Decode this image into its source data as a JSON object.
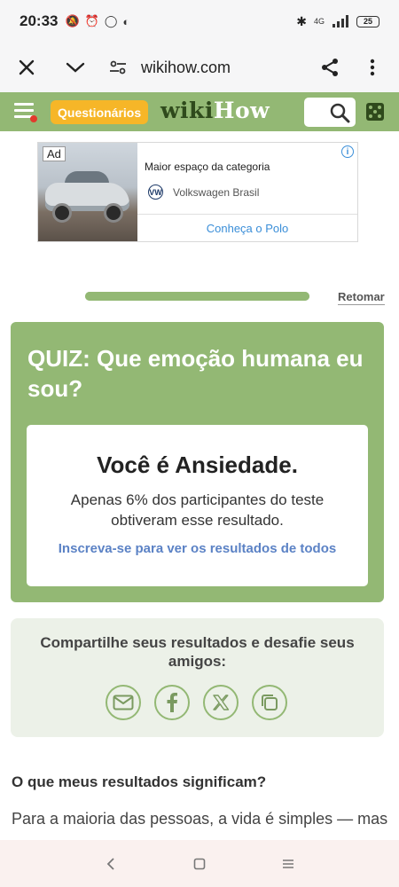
{
  "status_bar": {
    "time": "20:33",
    "network": "4G",
    "battery": "25"
  },
  "browser": {
    "url": "wikihow.com"
  },
  "header": {
    "quiz_pill_label": "Questionários",
    "logo_wiki": "wiki",
    "logo_how": "How",
    "accent_color": "#93b874",
    "pill_color": "#f6b628"
  },
  "ad": {
    "tag": "Ad",
    "headline": "Maior espaço da categoria",
    "brand": "Volkswagen Brasil",
    "cta": "Conheça o Polo"
  },
  "progress": {
    "fraction": 1.0,
    "resume_label": "Retomar"
  },
  "quiz": {
    "title": "QUIZ: Que emoção humana eu sou?",
    "result_title": "Você é Ansiedade.",
    "result_description": "Apenas 6% dos participantes do teste obtiveram esse resultado.",
    "result_link": "Inscreva-se para ver os resultados de todos"
  },
  "share": {
    "title": "Compartilhe seus resultados e desafie seus amigos:",
    "icons": [
      "email-icon",
      "facebook-icon",
      "x-icon",
      "copy-icon"
    ]
  },
  "article": {
    "heading": "O que meus resultados significam?",
    "text": "Para a maioria das pessoas, a vida é simples — mas"
  }
}
